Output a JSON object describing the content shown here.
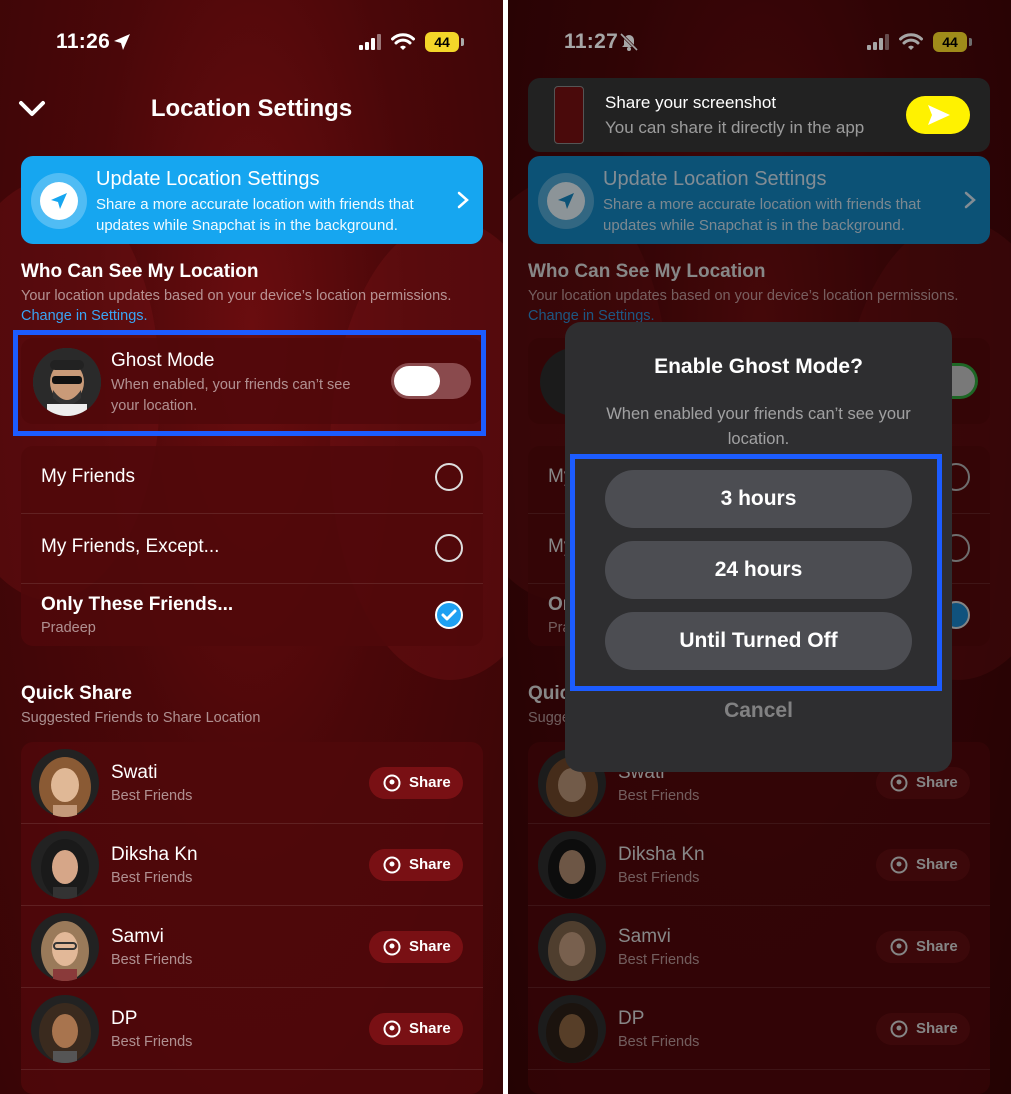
{
  "left": {
    "status": {
      "time": "11:26",
      "battery": "44"
    },
    "header": {
      "title": "Location Settings"
    },
    "banner": {
      "title": "Update Location Settings",
      "description": "Share a more accurate location with friends that updates while Snapchat is in the background."
    },
    "who_can_see": {
      "title": "Who Can See My Location",
      "subtitle": "Your location updates based on your device’s location permissions.",
      "link": "Change in Settings."
    },
    "ghost_mode": {
      "title": "Ghost Mode",
      "description": "When enabled, your friends can’t see your location."
    },
    "options": [
      {
        "label": "My Friends"
      },
      {
        "label": "My Friends, Except..."
      },
      {
        "label": "Only These Friends...",
        "sub": "Pradeep"
      }
    ],
    "quick_share": {
      "title": "Quick Share",
      "subtitle": "Suggested Friends to Share Location",
      "share_label": "Share",
      "friends": [
        {
          "name": "Swati",
          "status": "Best Friends"
        },
        {
          "name": "Diksha Kn",
          "status": "Best Friends"
        },
        {
          "name": "Samvi",
          "status": "Best Friends"
        },
        {
          "name": "DP",
          "status": "Best Friends"
        }
      ]
    }
  },
  "right": {
    "status": {
      "time": "11:27",
      "battery": "44"
    },
    "toast": {
      "title": "Share your screenshot",
      "subtitle": "You can share it directly in the app"
    },
    "dialog": {
      "title": "Enable Ghost Mode?",
      "description": "When enabled your friends can’t see your location.",
      "options": [
        "3 hours",
        "24 hours",
        "Until Turned Off"
      ],
      "cancel": "Cancel"
    }
  },
  "colors": {
    "background": "#4a0709",
    "banner": "#16a6f0",
    "highlight": "#1c5cff",
    "accent_check": "#1ea0f2",
    "send_button": "#fff200"
  }
}
